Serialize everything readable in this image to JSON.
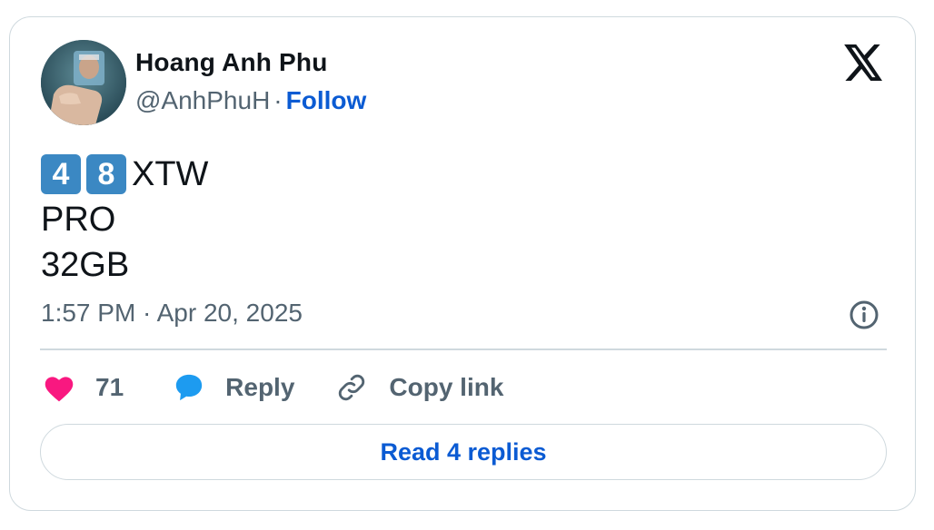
{
  "author": {
    "name": "Hoang Anh Phu",
    "handle": "@AnhPhuH",
    "separator": "·",
    "follow_label": "Follow"
  },
  "logo": {
    "icon": "x-logo-icon"
  },
  "tweet": {
    "keycaps": [
      "4",
      "8"
    ],
    "line1_suffix": "XTW",
    "line2": "PRO",
    "line3": "32GB"
  },
  "timestamp": "1:57 PM · Apr 20, 2025",
  "actions": {
    "like_count": "71",
    "reply_label": "Reply",
    "copy_label": "Copy link"
  },
  "read_replies_label": "Read 4 replies",
  "colors": {
    "link_blue": "#0b5bd3",
    "heart_pink": "#f91880",
    "reply_blue": "#1d9bf0",
    "keycap_blue": "#3b88c3",
    "muted_gray": "#536471",
    "border": "#cfd9de"
  }
}
